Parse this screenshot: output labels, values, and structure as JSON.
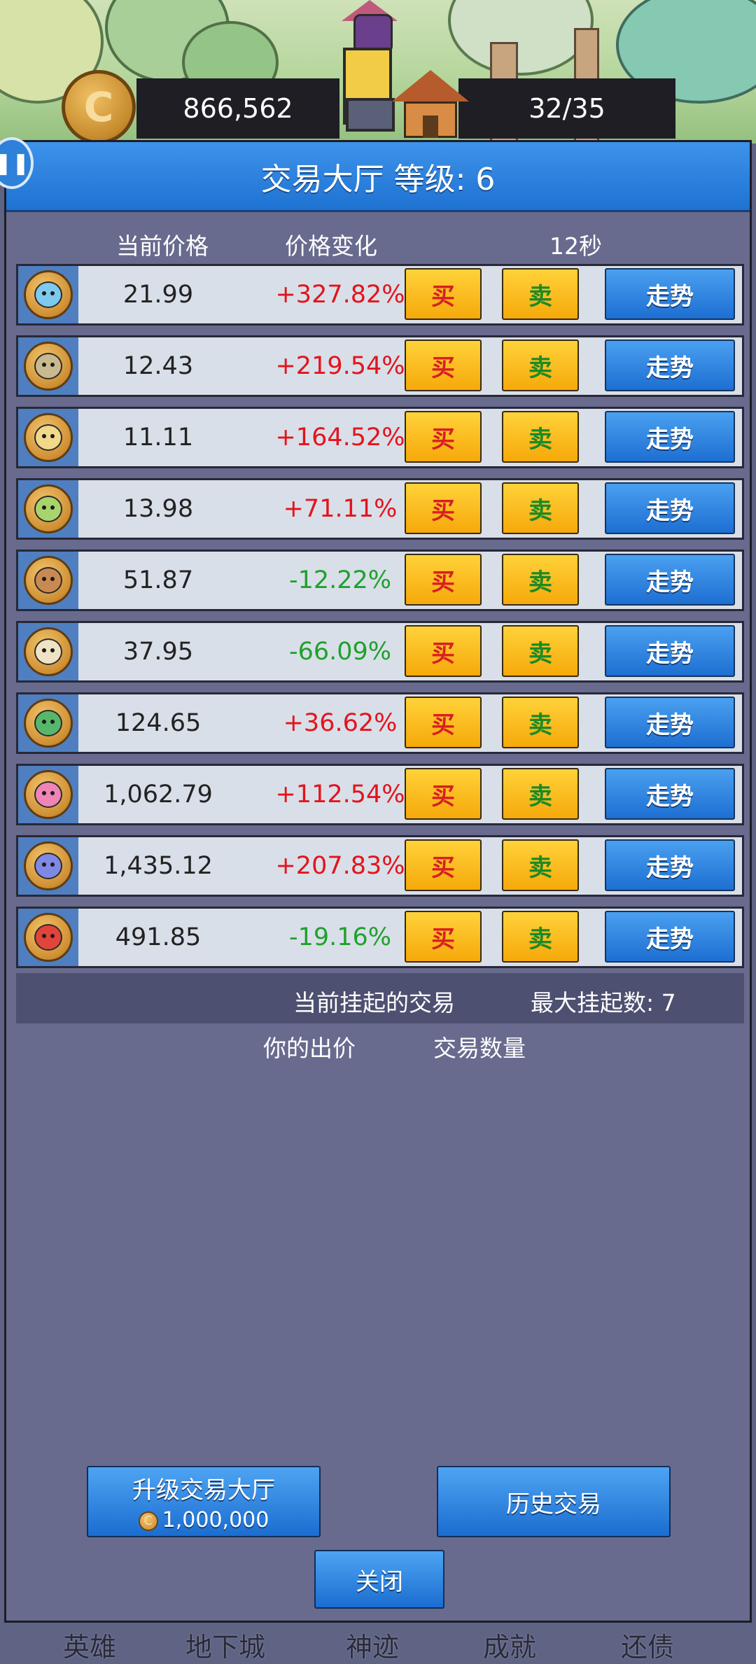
{
  "header": {
    "gold": "866,562",
    "capacity": "32/35",
    "gold_icon_glyph": "C",
    "menu_glyph": "❚❚"
  },
  "panel": {
    "title": "交易大厅 等级: 6",
    "col_price": "当前价格",
    "col_change": "价格变化",
    "timer": "12秒"
  },
  "items": [
    {
      "icon": "slime-coin-icon",
      "face_color": "#7ec9ee",
      "price": "21.99",
      "change": "+327.82%",
      "dir": "up"
    },
    {
      "icon": "zombie-coin-icon",
      "face_color": "#c9b98e",
      "price": "12.43",
      "change": "+219.54%",
      "dir": "up"
    },
    {
      "icon": "skull-coin-icon",
      "face_color": "#f1d88a",
      "price": "11.11",
      "change": "+164.52%",
      "dir": "up"
    },
    {
      "icon": "goblin-coin-icon",
      "face_color": "#a9d36b",
      "price": "13.98",
      "change": "+71.11%",
      "dir": "up"
    },
    {
      "icon": "treant-coin-icon",
      "face_color": "#c98a52",
      "price": "51.87",
      "change": "-12.22%",
      "dir": "down"
    },
    {
      "icon": "wolf-coin-icon",
      "face_color": "#efe3c4",
      "price": "37.95",
      "change": "-66.09%",
      "dir": "down"
    },
    {
      "icon": "orc-coin-icon",
      "face_color": "#56b76b",
      "price": "124.65",
      "change": "+36.62%",
      "dir": "up"
    },
    {
      "icon": "mushroom-coin-icon",
      "face_color": "#ef84b6",
      "price": "1,062.79",
      "change": "+112.54%",
      "dir": "up"
    },
    {
      "icon": "imp-coin-icon",
      "face_color": "#7f88e3",
      "price": "1,435.12",
      "change": "+207.83%",
      "dir": "up"
    },
    {
      "icon": "dragon-coin-icon",
      "face_color": "#e0443a",
      "price": "491.85",
      "change": "-19.16%",
      "dir": "down"
    }
  ],
  "buttons": {
    "buy": "买",
    "sell": "卖",
    "trend": "走势"
  },
  "pending": {
    "title": "当前挂起的交易",
    "max_label": "最大挂起数:  7",
    "col_bid": "你的出价",
    "col_qty": "交易数量"
  },
  "actions": {
    "upgrade_label": "升级交易大厅",
    "upgrade_cost": "1,000,000",
    "history_label": "历史交易",
    "close_label": "关闭"
  },
  "nav": [
    "英雄",
    "地下城",
    "神迹",
    "成就",
    "还债"
  ],
  "colors": {
    "up": "#e3141d",
    "down": "#1fa12c"
  }
}
